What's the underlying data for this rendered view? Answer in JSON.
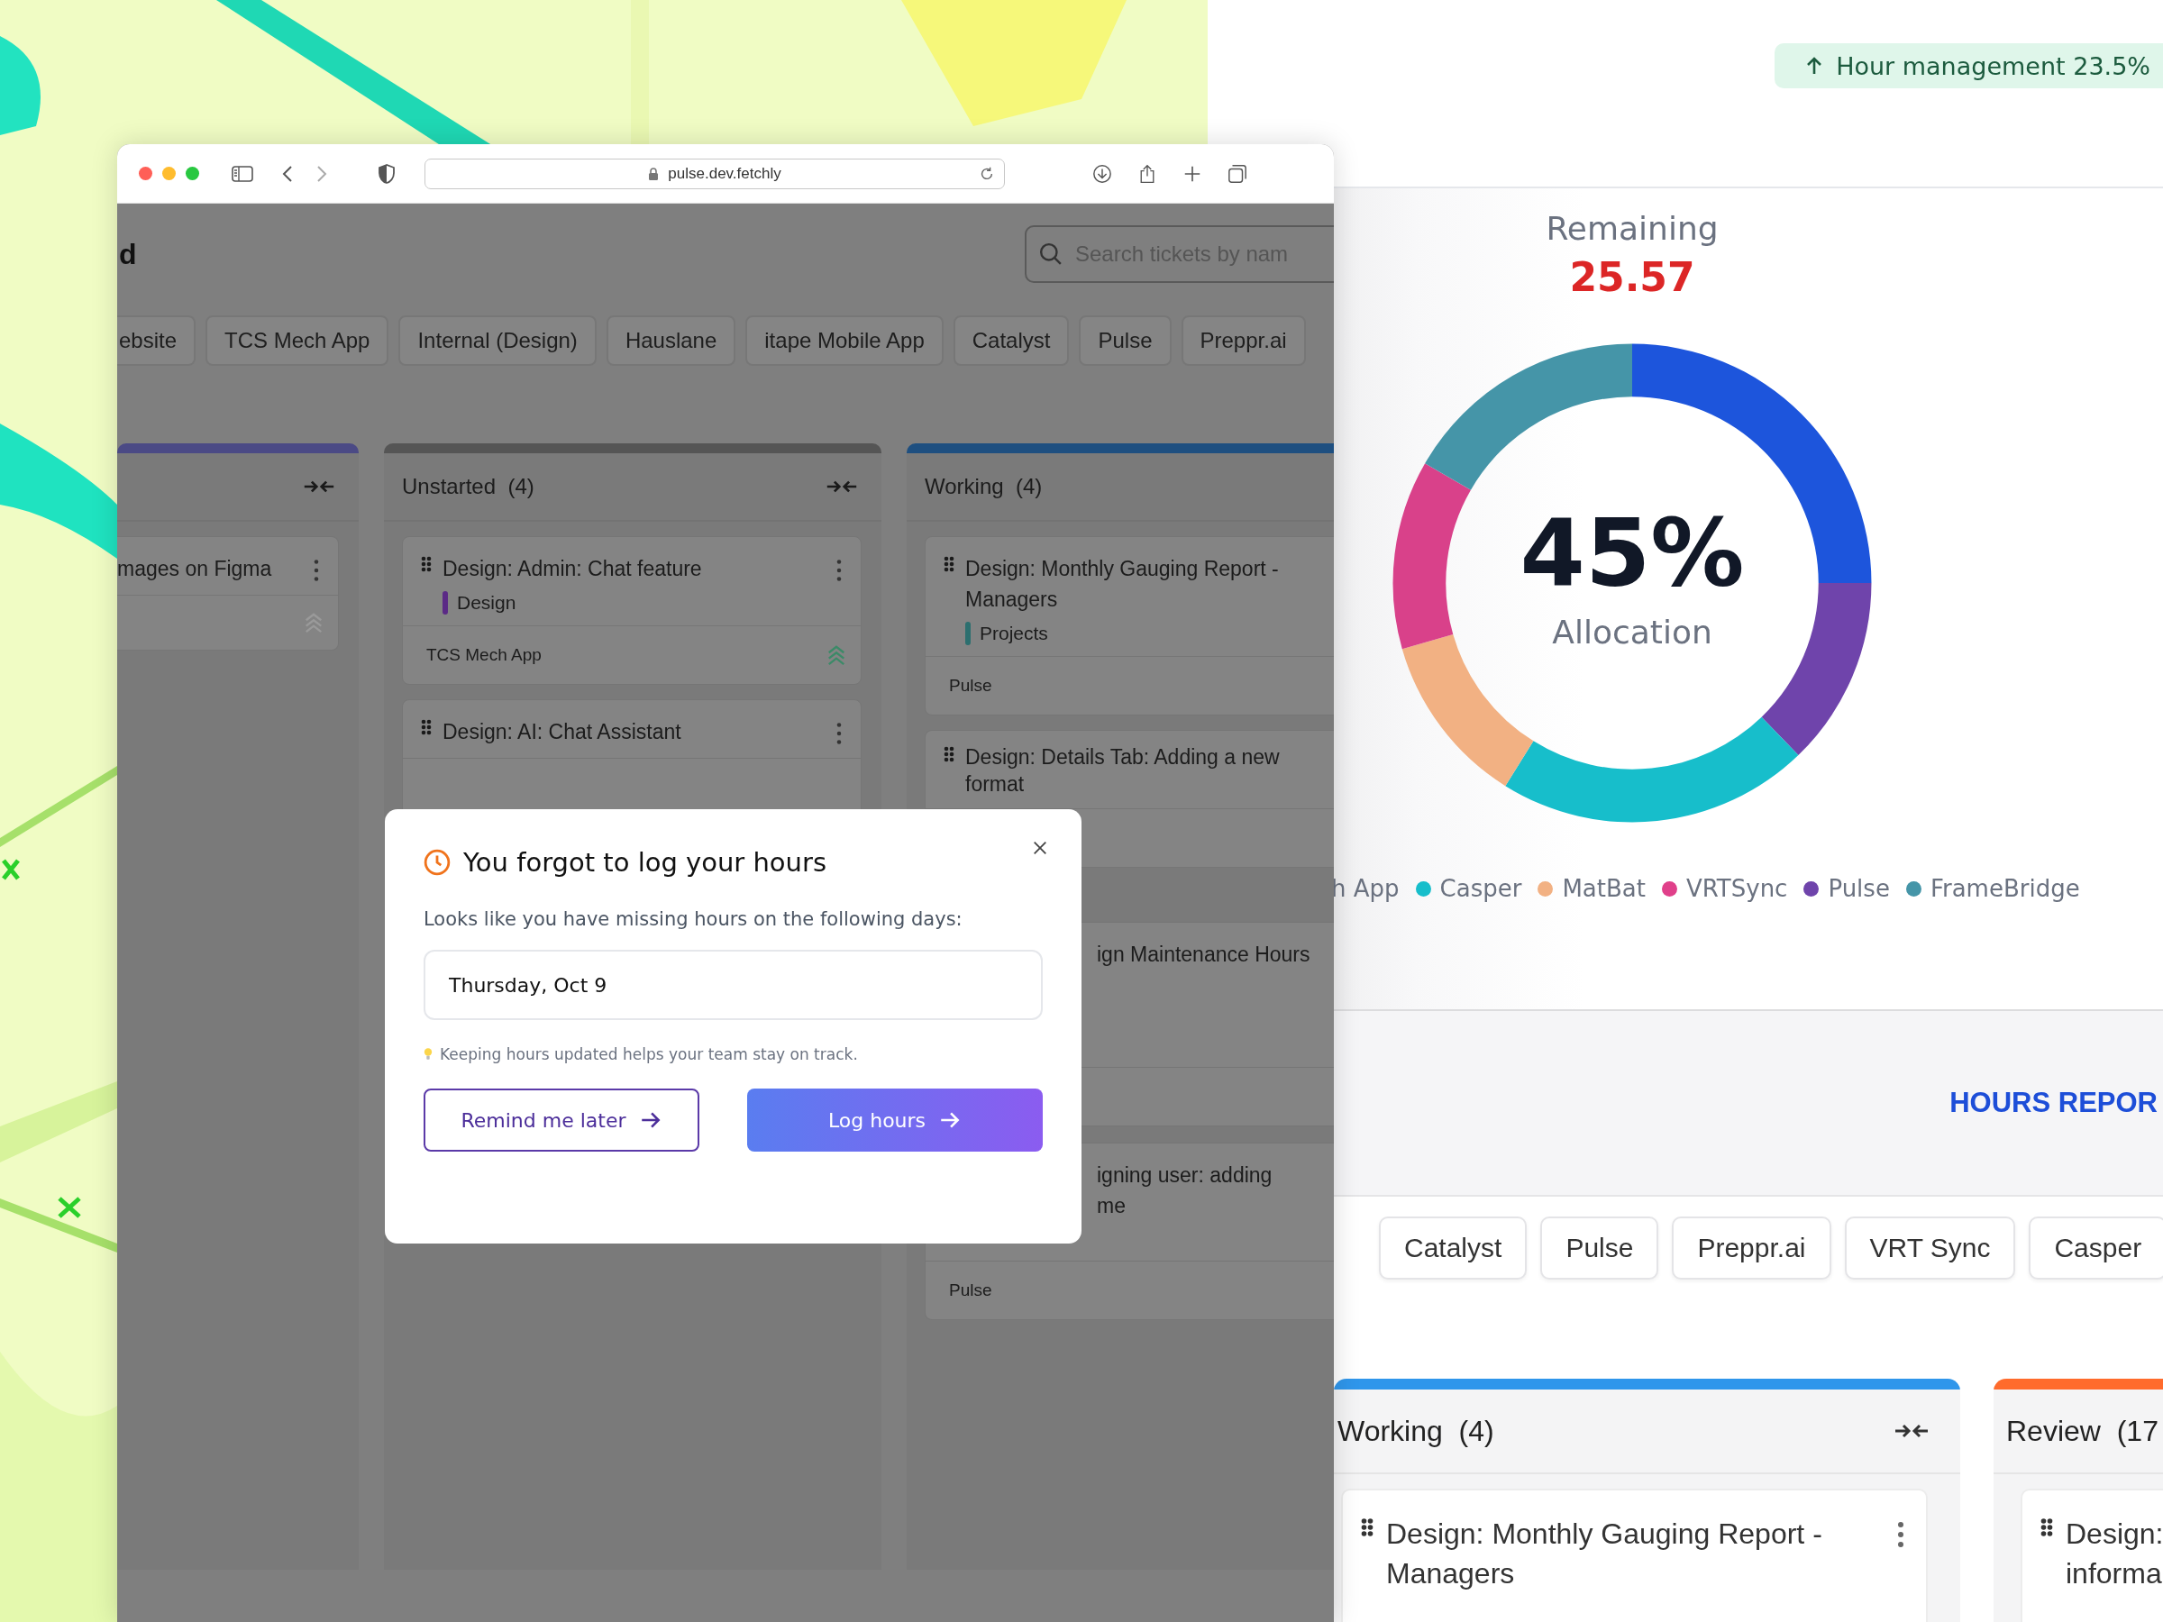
{
  "browser": {
    "url": "pulse.dev.fetchly",
    "heading": "d",
    "search": {
      "placeholder": "Search tickets by nam"
    },
    "project_tabs": [
      "ebsite",
      "TCS Mech App",
      "Internal (Design)",
      "Hauslane",
      "itape Mobile App",
      "Catalyst",
      "Pulse",
      "Preppr.ai"
    ],
    "columns": [
      {
        "color": "#4b4a85",
        "cards": [
          {
            "kind": "full",
            "lines": [
              "mages on Figma"
            ],
            "menu": true,
            "high_priority": false
          }
        ]
      },
      {
        "title": "Unstarted",
        "count": "(4)",
        "color": "#555555",
        "cards": [
          {
            "kind": "full",
            "lines": [
              "Design: Admin: Chat feature"
            ],
            "menu": true,
            "tag": {
              "label": "Design",
              "color": "#5b2a86"
            },
            "project": "TCS Mech App",
            "high_priority": true
          },
          {
            "kind": "full",
            "lines": [
              "Design: AI: Chat Assistant"
            ],
            "menu": true
          }
        ]
      },
      {
        "title": "Working",
        "count": "(4)",
        "color": "#1e4f80",
        "cards": [
          {
            "kind": "full",
            "lines": [
              "Design: Monthly Gauging Report -",
              "Managers"
            ],
            "tag": {
              "label": "Projects",
              "color": "#2c6f6f"
            },
            "project": "Pulse"
          },
          {
            "kind": "full",
            "lines": [
              "Design: Details Tab: Adding a new",
              "format"
            ]
          },
          {
            "kind": "partial",
            "lines": [
              "ign Maintenance Hours"
            ]
          },
          {
            "kind": "partial",
            "lines": [
              "igning user: adding",
              "me"
            ],
            "project": "Pulse"
          }
        ]
      }
    ]
  },
  "dialog": {
    "title": "You forgot to log your hours",
    "message": "Looks like you have missing hours on the following days:",
    "date": "Thursday, Oct 9",
    "hint": "Keeping hours updated helps your team stay on track.",
    "buttons": [
      {
        "label": "Remind me later",
        "kind": "secondary"
      },
      {
        "label": "Log hours",
        "kind": "primary"
      }
    ]
  },
  "report": {
    "badge": "Hour management 23.5%",
    "remaining_label": "Remaining",
    "remaining_value": "25.57",
    "allocation_value": "45%",
    "allocation_label": "Allocation",
    "legend": [
      {
        "label": "h App"
      },
      {
        "label": "Casper",
        "color": "#17becb"
      },
      {
        "label": "MatBat",
        "color": "#f2b183"
      },
      {
        "label": "VRTSync",
        "color": "#e0408a"
      },
      {
        "label": "Pulse",
        "color": "#6f44ab"
      },
      {
        "label": "FrameBridge",
        "color": "#4595a8"
      }
    ],
    "section_title": "HOURS REPOR",
    "project_tabs": [
      "Catalyst",
      "Pulse",
      "Preppr.ai",
      "VRT Sync",
      "Casper"
    ],
    "columns": [
      {
        "title": "Working",
        "count": "(4)",
        "color": "#2f96eb",
        "cards": [
          {
            "lines": [
              "Design: Monthly Gauging Report -",
              "Managers"
            ],
            "menu": true
          }
        ]
      },
      {
        "title": "Review",
        "count": "(17",
        "color": "#ff6b2c",
        "cards": [
          {
            "lines": [
              "Design:",
              "informa"
            ]
          }
        ]
      }
    ]
  }
}
